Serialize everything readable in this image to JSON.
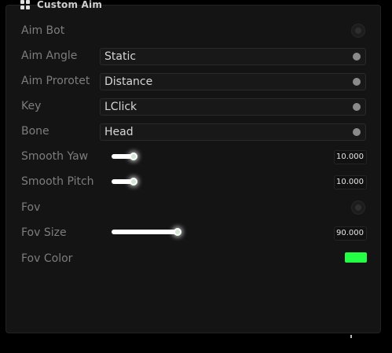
{
  "window": {
    "title": "Custom Aim"
  },
  "rows": {
    "aim_bot": {
      "label": "Aim Bot"
    },
    "aim_angle": {
      "label": "Aim Angle",
      "value": "Static"
    },
    "aim_prorotet": {
      "label": "Aim Prorotet",
      "value": "Distance"
    },
    "key": {
      "label": "Key",
      "value": "LClick"
    },
    "bone": {
      "label": "Bone",
      "value": "Head"
    },
    "smooth_yaw": {
      "label": "Smooth Yaw",
      "value_text": "10.000",
      "fill_fraction": 0.1
    },
    "smooth_pitch": {
      "label": "Smooth Pitch",
      "value_text": "10.000",
      "fill_fraction": 0.1
    },
    "fov": {
      "label": "Fov"
    },
    "fov_size": {
      "label": "Fov Size",
      "value_text": "90.000",
      "fill_fraction": 0.3
    },
    "fov_color": {
      "label": "Fov Color",
      "color": "#22ff44"
    }
  },
  "icons": {
    "title_icon": "grid-dots-icon",
    "toggle": "toggle-off-icon",
    "combo_arrow": "dropdown-dot-icon"
  },
  "colors": {
    "panel_bg": "#141414",
    "label": "#7d7d7d",
    "value": "#d6d6d6",
    "slider_fill": "#ffffff"
  }
}
